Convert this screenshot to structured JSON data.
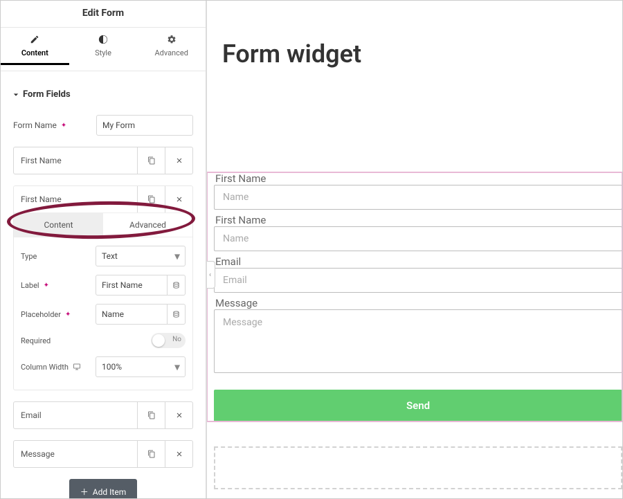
{
  "header": {
    "title": "Edit Form"
  },
  "tabs": {
    "content": "Content",
    "style": "Style",
    "advanced": "Advanced"
  },
  "section": {
    "form_fields": "Form Fields",
    "form_name_label": "Form Name",
    "form_name_value": "My Form"
  },
  "fields": {
    "item0": "First Name",
    "item1": "First Name",
    "item2": "Email",
    "item3": "Message"
  },
  "inner_tabs": {
    "content": "Content",
    "advanced": "Advanced"
  },
  "field_details": {
    "type_label": "Type",
    "type_value": "Text",
    "label_label": "Label",
    "label_value": "First Name",
    "placeholder_label": "Placeholder",
    "placeholder_value": "Name",
    "required_label": "Required",
    "required_value": "No",
    "col_width_label": "Column Width",
    "col_width_value": "100%"
  },
  "add_item": "Add Item",
  "preview": {
    "title": "Form widget",
    "field0_label": "First Name",
    "field0_placeholder": "Name",
    "field1_label": "First Name",
    "field1_placeholder": "Name",
    "field2_label": "Email",
    "field2_placeholder": "Email",
    "field3_label": "Message",
    "field3_placeholder": "Message",
    "send": "Send"
  },
  "colors": {
    "send_bg": "#61ce70",
    "highlight": "#821a3d",
    "selection": "#e8b9d6"
  }
}
